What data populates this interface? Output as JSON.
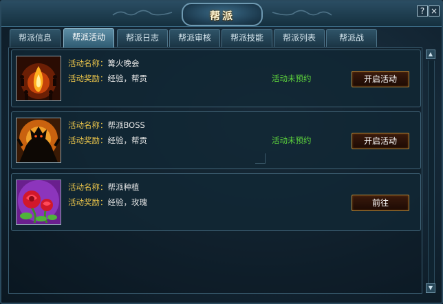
{
  "window": {
    "title": "帮派",
    "help_icon": "?",
    "close_icon": "×"
  },
  "tabs": [
    {
      "label": "帮派信息",
      "active": false
    },
    {
      "label": "帮派活动",
      "active": true
    },
    {
      "label": "帮派日志",
      "active": false
    },
    {
      "label": "帮派审核",
      "active": false
    },
    {
      "label": "帮派技能",
      "active": false
    },
    {
      "label": "帮派列表",
      "active": false
    },
    {
      "label": "帮派战",
      "active": false
    }
  ],
  "labels": {
    "name_key": "活动名称：",
    "reward_key": "活动奖励："
  },
  "activities": [
    {
      "icon": "bonfire-icon",
      "name": "篝火晚会",
      "reward": "经验，帮贡",
      "status": "活动未预约",
      "button": "开启活动"
    },
    {
      "icon": "boss-icon",
      "name": "帮派BOSS",
      "reward": "经验，帮贡",
      "status": "活动未预约",
      "button": "开启活动"
    },
    {
      "icon": "rose-icon",
      "name": "帮派种植",
      "reward": "经验，玫瑰",
      "status": "",
      "button": "前往"
    }
  ],
  "colors": {
    "label": "#e7c24a",
    "status": "#5dd43c",
    "accent_border": "#b38a3c"
  }
}
